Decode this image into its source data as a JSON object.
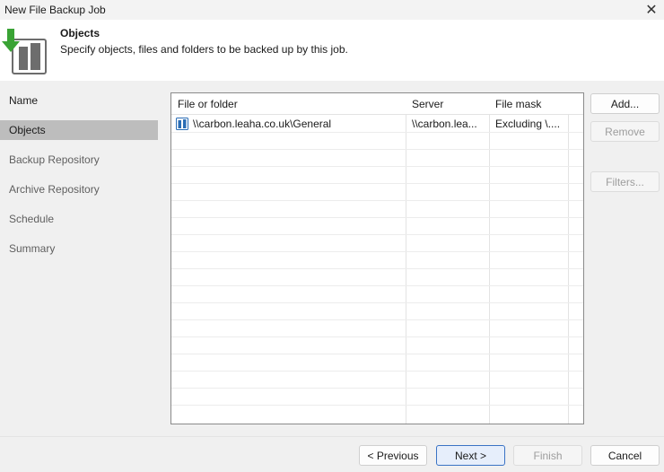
{
  "window": {
    "title": "New File Backup Job",
    "close_glyph": "✕"
  },
  "header": {
    "title": "Objects",
    "subtitle": "Specify objects, files and folders to be backed up by this job.",
    "icon": "backup-job-icon"
  },
  "sidebar": {
    "items": [
      {
        "label": "Name",
        "state": "done"
      },
      {
        "label": "Objects",
        "state": "active"
      },
      {
        "label": "Backup Repository",
        "state": "pending"
      },
      {
        "label": "Archive Repository",
        "state": "pending"
      },
      {
        "label": "Schedule",
        "state": "pending"
      },
      {
        "label": "Summary",
        "state": "pending"
      }
    ]
  },
  "table": {
    "columns": [
      "File or folder",
      "Server",
      "File mask"
    ],
    "rows": [
      {
        "path": "\\\\carbon.leaha.co.uk\\General",
        "server": "\\\\carbon.lea...",
        "mask": "Excluding \\...."
      }
    ]
  },
  "side_buttons": {
    "add": "Add...",
    "remove": "Remove",
    "filters": "Filters..."
  },
  "footer_buttons": {
    "previous": "< Previous",
    "next": "Next >",
    "finish": "Finish",
    "cancel": "Cancel"
  },
  "colors": {
    "active_item": "#bdbdbd",
    "accent": "#3a73c4",
    "logo_green": "#3aa335",
    "logo_gray": "#6d6d6d"
  }
}
